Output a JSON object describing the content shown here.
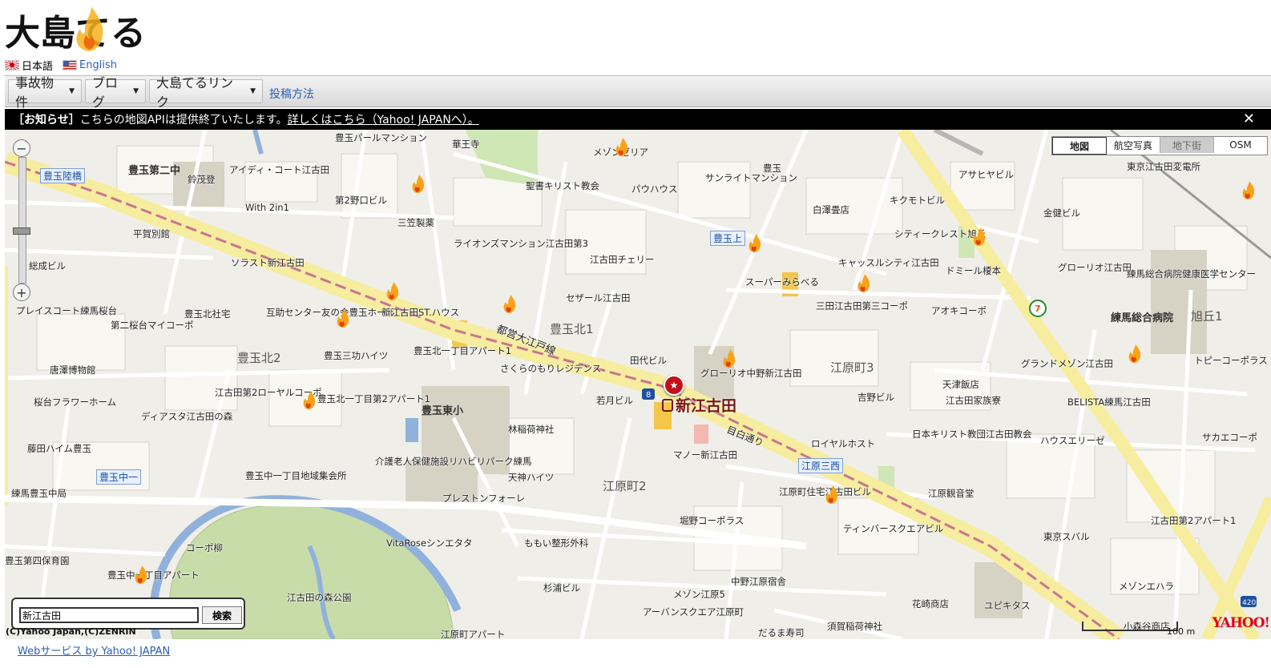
{
  "logo": {
    "text": "大島てる"
  },
  "languages": [
    {
      "label": "日本語"
    },
    {
      "label": "English"
    }
  ],
  "nav": {
    "tabs": [
      {
        "label": "事故物件"
      },
      {
        "label": "ブログ"
      },
      {
        "label": "大島てるリンク"
      }
    ],
    "link": "投稿方法"
  },
  "notice": {
    "head": "［お知らせ］",
    "text": "こちらの地図APIは提供終了いたします。",
    "link": "詳しくはこちら（Yahoo! JAPANへ）。",
    "close": "✕"
  },
  "map": {
    "types": [
      {
        "label": "地図",
        "state": "active"
      },
      {
        "label": "航空写真",
        "state": "normal"
      },
      {
        "label": "地下街",
        "state": "disabled"
      },
      {
        "label": "OSM",
        "state": "normal"
      }
    ],
    "zoom_in": "+",
    "zoom_out": "−",
    "station": "新江古田",
    "search": {
      "value": "新江古田",
      "button": "検索"
    },
    "copyright": "(C)Yahoo Japan,(C)ZENRIN",
    "scale": "100 m",
    "yahoo_logo": "YAHOO!",
    "labels": {
      "l1": "豊玉第二中",
      "l2": "豊玉陸橋",
      "l3": "鈴茂登",
      "l4": "アイディ・コート江古田",
      "l5": "With 2in1",
      "l6": "第2野口ビル",
      "l7": "三笠製薬",
      "l8": "豊玉パールマンション",
      "l9": "華王寺",
      "l10": "聖書キリスト教会",
      "l11": "パウハウス",
      "l12": "メゾンゼリア",
      "l13": "サンライトマンション",
      "l14": "豊玉",
      "l15": "白澤畳店",
      "l16": "キクモトビル",
      "l17": "アサヒヤビル",
      "l18": "東京江古田変電所",
      "l19": "金健ビル",
      "l20": "シティークレスト旭丘",
      "l21": "ドミール榎本",
      "l22": "グローリオ江古田",
      "l23": "練馬総合病院健康医学センター",
      "l24": "練馬総合病院",
      "l25": "旭丘1",
      "l26": "ソラスト新江古田",
      "l27": "ライオンズマンション江古田第3",
      "l28": "江古田チェリー",
      "l29": "豊玉上",
      "l30": "スーパーみらべる",
      "l31": "キャッスルシティ江古田",
      "l32": "三田江古田第三コーポ",
      "l33": "アオキコーポ",
      "l34": "セザール江古田",
      "l35": "互助センター友の会豊玉ホール",
      "l36": "新江古田ST.ハウス",
      "l37": "豊玉北1",
      "l38": "都営大江戸線",
      "l39": "田代ビル",
      "l40": "グローリオ中野新江古田",
      "l41": "江原町3",
      "l42": "天津飯店",
      "l43": "グランドメゾン江古田",
      "l44": "トピーコーポラス",
      "l45": "第二桜台マイコーポ",
      "l46": "豊玉北社宅",
      "l47": "豊玉北2",
      "l48": "豊玉三功ハイツ",
      "l49": "豊玉北一丁目アパート1",
      "l50": "さくらのもりレジデンス",
      "l51": "唐澤博物館",
      "l52": "江古田第2ローヤルコーポ",
      "l53": "豊玉北一丁目第2アパート1",
      "l54": "豊玉東小",
      "l55": "若月ビル",
      "l56": "吉野ビル",
      "l57": "江古田家族寮",
      "l58": "BELISTA練馬江古田",
      "l59": "桜台フラワーホーム",
      "l60": "ディアスタ江古田の森",
      "l61": "林稲荷神社",
      "l62": "目白通り",
      "l63": "ロイヤルホスト",
      "l64": "日本キリスト教団江古田教会",
      "l65": "ハウスエリーゼ",
      "l66": "サカエコーポ",
      "l67": "藤田ハイム豊玉",
      "l68": "介護老人保健施設リハビリパーク練馬",
      "l69": "天神ハイツ",
      "l70": "マノー新江古田",
      "l71": "江原三西",
      "l72": "豊玉中一",
      "l73": "豊玉中一丁目地域集会所",
      "l74": "練馬豊玉中局",
      "l75": "プレストンフォーレ",
      "l76": "江原町2",
      "l77": "江原町住宅江古田ビル",
      "l78": "江原観音堂",
      "l79": "東京スバル",
      "l80": "江古田第2アパート1",
      "l81": "豊玉第四保育園",
      "l82": "コーポ柳",
      "l83": "豊玉中一丁目アパート",
      "l84": "VitaRoseシンエタタ",
      "l85": "ももい整形外科",
      "l86": "堀野コーポラス",
      "l87": "ティンバースクエアビル",
      "l88": "江古田の森公園",
      "l89": "杉浦ビル",
      "l90": "中野江原宿舎",
      "l91": "メゾン江原5",
      "l92": "アーバンスクエア江原町",
      "l93": "花崎商店",
      "l94": "ユピキタス",
      "l95": "メゾンエハラ",
      "l96": "須賀稲荷神社",
      "l97": "だるま寿司",
      "l98": "江原町アパート",
      "l99": "小森谷商店",
      "l100": "プレイスコート練馬桜台",
      "l101": "総成ビル",
      "l102": "平賀別館"
    }
  },
  "footer": {
    "link": "Webサービス by Yahoo! JAPAN"
  }
}
